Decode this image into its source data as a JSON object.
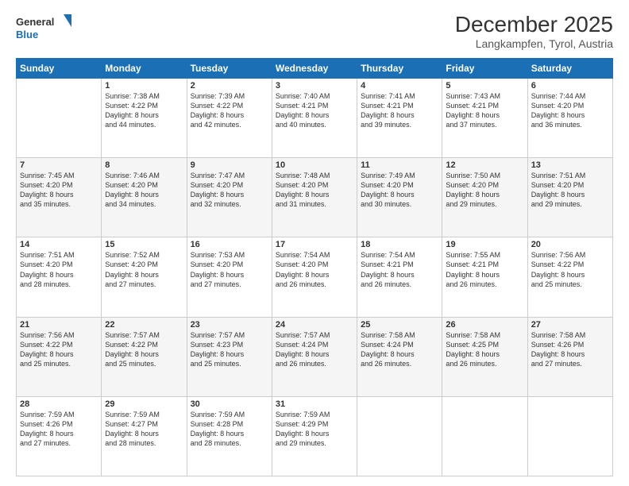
{
  "logo": {
    "line1": "General",
    "line2": "Blue"
  },
  "header": {
    "title": "December 2025",
    "subtitle": "Langkampfen, Tyrol, Austria"
  },
  "weekdays": [
    "Sunday",
    "Monday",
    "Tuesday",
    "Wednesday",
    "Thursday",
    "Friday",
    "Saturday"
  ],
  "weeks": [
    [
      {
        "day": "",
        "info": ""
      },
      {
        "day": "1",
        "info": "Sunrise: 7:38 AM\nSunset: 4:22 PM\nDaylight: 8 hours\nand 44 minutes."
      },
      {
        "day": "2",
        "info": "Sunrise: 7:39 AM\nSunset: 4:22 PM\nDaylight: 8 hours\nand 42 minutes."
      },
      {
        "day": "3",
        "info": "Sunrise: 7:40 AM\nSunset: 4:21 PM\nDaylight: 8 hours\nand 40 minutes."
      },
      {
        "day": "4",
        "info": "Sunrise: 7:41 AM\nSunset: 4:21 PM\nDaylight: 8 hours\nand 39 minutes."
      },
      {
        "day": "5",
        "info": "Sunrise: 7:43 AM\nSunset: 4:21 PM\nDaylight: 8 hours\nand 37 minutes."
      },
      {
        "day": "6",
        "info": "Sunrise: 7:44 AM\nSunset: 4:20 PM\nDaylight: 8 hours\nand 36 minutes."
      }
    ],
    [
      {
        "day": "7",
        "info": "Sunrise: 7:45 AM\nSunset: 4:20 PM\nDaylight: 8 hours\nand 35 minutes."
      },
      {
        "day": "8",
        "info": "Sunrise: 7:46 AM\nSunset: 4:20 PM\nDaylight: 8 hours\nand 34 minutes."
      },
      {
        "day": "9",
        "info": "Sunrise: 7:47 AM\nSunset: 4:20 PM\nDaylight: 8 hours\nand 32 minutes."
      },
      {
        "day": "10",
        "info": "Sunrise: 7:48 AM\nSunset: 4:20 PM\nDaylight: 8 hours\nand 31 minutes."
      },
      {
        "day": "11",
        "info": "Sunrise: 7:49 AM\nSunset: 4:20 PM\nDaylight: 8 hours\nand 30 minutes."
      },
      {
        "day": "12",
        "info": "Sunrise: 7:50 AM\nSunset: 4:20 PM\nDaylight: 8 hours\nand 29 minutes."
      },
      {
        "day": "13",
        "info": "Sunrise: 7:51 AM\nSunset: 4:20 PM\nDaylight: 8 hours\nand 29 minutes."
      }
    ],
    [
      {
        "day": "14",
        "info": "Sunrise: 7:51 AM\nSunset: 4:20 PM\nDaylight: 8 hours\nand 28 minutes."
      },
      {
        "day": "15",
        "info": "Sunrise: 7:52 AM\nSunset: 4:20 PM\nDaylight: 8 hours\nand 27 minutes."
      },
      {
        "day": "16",
        "info": "Sunrise: 7:53 AM\nSunset: 4:20 PM\nDaylight: 8 hours\nand 27 minutes."
      },
      {
        "day": "17",
        "info": "Sunrise: 7:54 AM\nSunset: 4:20 PM\nDaylight: 8 hours\nand 26 minutes."
      },
      {
        "day": "18",
        "info": "Sunrise: 7:54 AM\nSunset: 4:21 PM\nDaylight: 8 hours\nand 26 minutes."
      },
      {
        "day": "19",
        "info": "Sunrise: 7:55 AM\nSunset: 4:21 PM\nDaylight: 8 hours\nand 26 minutes."
      },
      {
        "day": "20",
        "info": "Sunrise: 7:56 AM\nSunset: 4:22 PM\nDaylight: 8 hours\nand 25 minutes."
      }
    ],
    [
      {
        "day": "21",
        "info": "Sunrise: 7:56 AM\nSunset: 4:22 PM\nDaylight: 8 hours\nand 25 minutes."
      },
      {
        "day": "22",
        "info": "Sunrise: 7:57 AM\nSunset: 4:22 PM\nDaylight: 8 hours\nand 25 minutes."
      },
      {
        "day": "23",
        "info": "Sunrise: 7:57 AM\nSunset: 4:23 PM\nDaylight: 8 hours\nand 25 minutes."
      },
      {
        "day": "24",
        "info": "Sunrise: 7:57 AM\nSunset: 4:24 PM\nDaylight: 8 hours\nand 26 minutes."
      },
      {
        "day": "25",
        "info": "Sunrise: 7:58 AM\nSunset: 4:24 PM\nDaylight: 8 hours\nand 26 minutes."
      },
      {
        "day": "26",
        "info": "Sunrise: 7:58 AM\nSunset: 4:25 PM\nDaylight: 8 hours\nand 26 minutes."
      },
      {
        "day": "27",
        "info": "Sunrise: 7:58 AM\nSunset: 4:26 PM\nDaylight: 8 hours\nand 27 minutes."
      }
    ],
    [
      {
        "day": "28",
        "info": "Sunrise: 7:59 AM\nSunset: 4:26 PM\nDaylight: 8 hours\nand 27 minutes."
      },
      {
        "day": "29",
        "info": "Sunrise: 7:59 AM\nSunset: 4:27 PM\nDaylight: 8 hours\nand 28 minutes."
      },
      {
        "day": "30",
        "info": "Sunrise: 7:59 AM\nSunset: 4:28 PM\nDaylight: 8 hours\nand 28 minutes."
      },
      {
        "day": "31",
        "info": "Sunrise: 7:59 AM\nSunset: 4:29 PM\nDaylight: 8 hours\nand 29 minutes."
      },
      {
        "day": "",
        "info": ""
      },
      {
        "day": "",
        "info": ""
      },
      {
        "day": "",
        "info": ""
      }
    ]
  ]
}
